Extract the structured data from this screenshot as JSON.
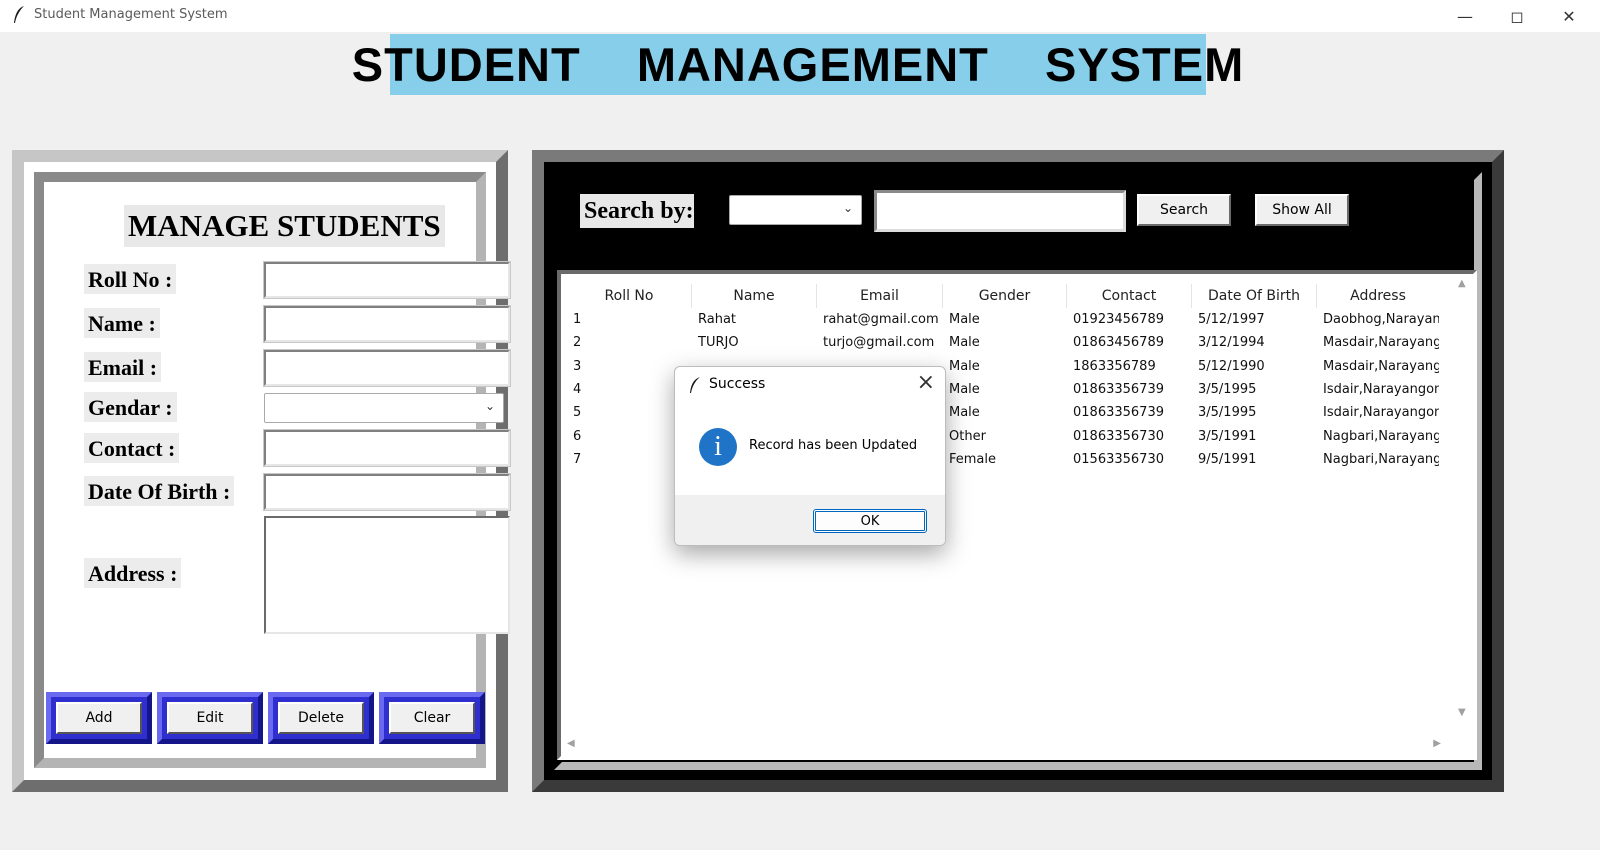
{
  "window": {
    "title": "Student Management System"
  },
  "banner": "STUDENT  MANAGEMENT  SYSTEM",
  "form": {
    "title": "MANAGE STUDENTS",
    "labels": {
      "roll": "Roll No :",
      "name": "Name :",
      "email": "Email :",
      "gender": "Gendar :",
      "contact": "Contact :",
      "dob": "Date Of Birth :",
      "address": "Address :"
    },
    "buttons": {
      "add": "Add",
      "edit": "Edit",
      "delete": "Delete",
      "clear": "Clear"
    }
  },
  "search": {
    "label": "Search by:",
    "search_button": "Search",
    "show_all_button": "Show All"
  },
  "table": {
    "columns": [
      "Roll No",
      "Name",
      "Email",
      "Gender",
      "Contact",
      "Date Of Birth",
      "Address"
    ],
    "rows": [
      {
        "roll": "1",
        "name": "Rahat",
        "email": "rahat@gmail.com",
        "gender": "Male",
        "contact": "01923456789",
        "dob": "5/12/1997",
        "address": "Daobhog,Narayan("
      },
      {
        "roll": "2",
        "name": "TURJO",
        "email": "turjo@gmail.com",
        "gender": "Male",
        "contact": "01863456789",
        "dob": "3/12/1994",
        "address": "Masdair,Narayang("
      },
      {
        "roll": "3",
        "name": "",
        "email": "",
        "gender": "Male",
        "contact": "1863356789",
        "dob": "5/12/1990",
        "address": "Masdair,Narayang("
      },
      {
        "roll": "4",
        "name": "",
        "email": "",
        "gender": "Male",
        "contact": "01863356739",
        "dob": "3/5/1995",
        "address": "Isdair,Narayangonj"
      },
      {
        "roll": "5",
        "name": "",
        "email": "",
        "gender": "Male",
        "contact": "01863356739",
        "dob": "3/5/1995",
        "address": "Isdair,Narayangonj"
      },
      {
        "roll": "6",
        "name": "",
        "email": "",
        "gender": "Other",
        "contact": "01863356730",
        "dob": "3/5/1991",
        "address": "Nagbari,Narayang("
      },
      {
        "roll": "7",
        "name": "",
        "email": "",
        "gender": "Female",
        "contact": "01563356730",
        "dob": "9/5/1991",
        "address": "Nagbari,Narayang("
      }
    ]
  },
  "dialog": {
    "title": "Success",
    "message": "Record has been Updated",
    "ok": "OK"
  }
}
